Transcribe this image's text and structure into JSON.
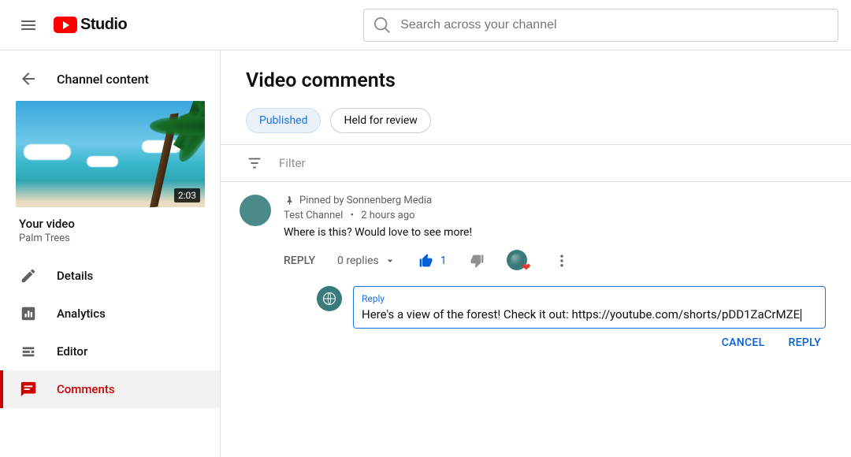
{
  "header": {
    "logo_text": "Studio",
    "search_placeholder": "Search across your channel"
  },
  "sidebar": {
    "back_label": "Channel content",
    "video": {
      "duration": "2:03",
      "section_label": "Your video",
      "title": "Palm Trees"
    },
    "nav": [
      {
        "label": "Details"
      },
      {
        "label": "Analytics"
      },
      {
        "label": "Editor"
      },
      {
        "label": "Comments"
      }
    ]
  },
  "main": {
    "title": "Video comments",
    "tabs": [
      {
        "label": "Published",
        "active": true
      },
      {
        "label": "Held for review",
        "active": false
      }
    ],
    "filter_placeholder": "Filter"
  },
  "comment": {
    "pinned_by": "Pinned by Sonnenberg Media",
    "author": "Test Channel",
    "time": "2 hours ago",
    "text": "Where is this? Would love to see more!",
    "reply_label": "REPLY",
    "replies_toggle": "0 replies",
    "like_count": "1"
  },
  "reply": {
    "field_label": "Reply",
    "text": "Here's a view of the forest! Check it out: https://youtube.com/shorts/pDD1ZaCrMZE",
    "cancel": "CANCEL",
    "submit": "REPLY"
  }
}
